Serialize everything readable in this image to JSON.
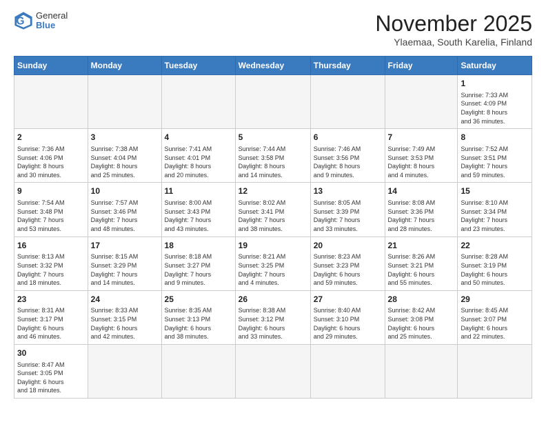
{
  "header": {
    "logo_general": "General",
    "logo_blue": "Blue",
    "month_title": "November 2025",
    "location": "Ylaemaa, South Karelia, Finland"
  },
  "weekdays": [
    "Sunday",
    "Monday",
    "Tuesday",
    "Wednesday",
    "Thursday",
    "Friday",
    "Saturday"
  ],
  "weeks": [
    [
      {
        "day": "",
        "info": ""
      },
      {
        "day": "",
        "info": ""
      },
      {
        "day": "",
        "info": ""
      },
      {
        "day": "",
        "info": ""
      },
      {
        "day": "",
        "info": ""
      },
      {
        "day": "",
        "info": ""
      },
      {
        "day": "1",
        "info": "Sunrise: 7:33 AM\nSunset: 4:09 PM\nDaylight: 8 hours\nand 36 minutes."
      }
    ],
    [
      {
        "day": "2",
        "info": "Sunrise: 7:36 AM\nSunset: 4:06 PM\nDaylight: 8 hours\nand 30 minutes."
      },
      {
        "day": "3",
        "info": "Sunrise: 7:38 AM\nSunset: 4:04 PM\nDaylight: 8 hours\nand 25 minutes."
      },
      {
        "day": "4",
        "info": "Sunrise: 7:41 AM\nSunset: 4:01 PM\nDaylight: 8 hours\nand 20 minutes."
      },
      {
        "day": "5",
        "info": "Sunrise: 7:44 AM\nSunset: 3:58 PM\nDaylight: 8 hours\nand 14 minutes."
      },
      {
        "day": "6",
        "info": "Sunrise: 7:46 AM\nSunset: 3:56 PM\nDaylight: 8 hours\nand 9 minutes."
      },
      {
        "day": "7",
        "info": "Sunrise: 7:49 AM\nSunset: 3:53 PM\nDaylight: 8 hours\nand 4 minutes."
      },
      {
        "day": "8",
        "info": "Sunrise: 7:52 AM\nSunset: 3:51 PM\nDaylight: 7 hours\nand 59 minutes."
      }
    ],
    [
      {
        "day": "9",
        "info": "Sunrise: 7:54 AM\nSunset: 3:48 PM\nDaylight: 7 hours\nand 53 minutes."
      },
      {
        "day": "10",
        "info": "Sunrise: 7:57 AM\nSunset: 3:46 PM\nDaylight: 7 hours\nand 48 minutes."
      },
      {
        "day": "11",
        "info": "Sunrise: 8:00 AM\nSunset: 3:43 PM\nDaylight: 7 hours\nand 43 minutes."
      },
      {
        "day": "12",
        "info": "Sunrise: 8:02 AM\nSunset: 3:41 PM\nDaylight: 7 hours\nand 38 minutes."
      },
      {
        "day": "13",
        "info": "Sunrise: 8:05 AM\nSunset: 3:39 PM\nDaylight: 7 hours\nand 33 minutes."
      },
      {
        "day": "14",
        "info": "Sunrise: 8:08 AM\nSunset: 3:36 PM\nDaylight: 7 hours\nand 28 minutes."
      },
      {
        "day": "15",
        "info": "Sunrise: 8:10 AM\nSunset: 3:34 PM\nDaylight: 7 hours\nand 23 minutes."
      }
    ],
    [
      {
        "day": "16",
        "info": "Sunrise: 8:13 AM\nSunset: 3:32 PM\nDaylight: 7 hours\nand 18 minutes."
      },
      {
        "day": "17",
        "info": "Sunrise: 8:15 AM\nSunset: 3:29 PM\nDaylight: 7 hours\nand 14 minutes."
      },
      {
        "day": "18",
        "info": "Sunrise: 8:18 AM\nSunset: 3:27 PM\nDaylight: 7 hours\nand 9 minutes."
      },
      {
        "day": "19",
        "info": "Sunrise: 8:21 AM\nSunset: 3:25 PM\nDaylight: 7 hours\nand 4 minutes."
      },
      {
        "day": "20",
        "info": "Sunrise: 8:23 AM\nSunset: 3:23 PM\nDaylight: 6 hours\nand 59 minutes."
      },
      {
        "day": "21",
        "info": "Sunrise: 8:26 AM\nSunset: 3:21 PM\nDaylight: 6 hours\nand 55 minutes."
      },
      {
        "day": "22",
        "info": "Sunrise: 8:28 AM\nSunset: 3:19 PM\nDaylight: 6 hours\nand 50 minutes."
      }
    ],
    [
      {
        "day": "23",
        "info": "Sunrise: 8:31 AM\nSunset: 3:17 PM\nDaylight: 6 hours\nand 46 minutes."
      },
      {
        "day": "24",
        "info": "Sunrise: 8:33 AM\nSunset: 3:15 PM\nDaylight: 6 hours\nand 42 minutes."
      },
      {
        "day": "25",
        "info": "Sunrise: 8:35 AM\nSunset: 3:13 PM\nDaylight: 6 hours\nand 38 minutes."
      },
      {
        "day": "26",
        "info": "Sunrise: 8:38 AM\nSunset: 3:12 PM\nDaylight: 6 hours\nand 33 minutes."
      },
      {
        "day": "27",
        "info": "Sunrise: 8:40 AM\nSunset: 3:10 PM\nDaylight: 6 hours\nand 29 minutes."
      },
      {
        "day": "28",
        "info": "Sunrise: 8:42 AM\nSunset: 3:08 PM\nDaylight: 6 hours\nand 25 minutes."
      },
      {
        "day": "29",
        "info": "Sunrise: 8:45 AM\nSunset: 3:07 PM\nDaylight: 6 hours\nand 22 minutes."
      }
    ],
    [
      {
        "day": "30",
        "info": "Sunrise: 8:47 AM\nSunset: 3:05 PM\nDaylight: 6 hours\nand 18 minutes."
      },
      {
        "day": "",
        "info": ""
      },
      {
        "day": "",
        "info": ""
      },
      {
        "day": "",
        "info": ""
      },
      {
        "day": "",
        "info": ""
      },
      {
        "day": "",
        "info": ""
      },
      {
        "day": "",
        "info": ""
      }
    ]
  ]
}
